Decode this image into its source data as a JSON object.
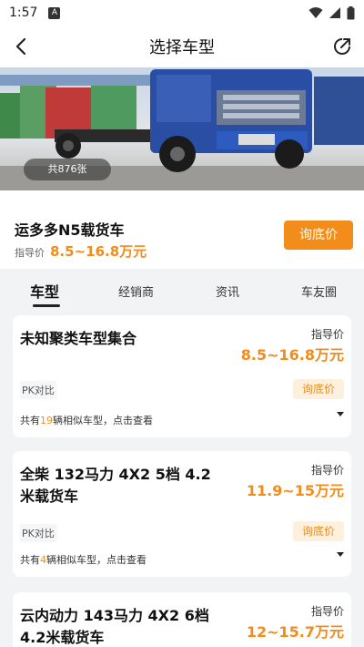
{
  "status_bar": {
    "time": "1:57",
    "app_indicator": "A"
  },
  "nav": {
    "title": "选择车型",
    "back_icon": "back-arrow-icon",
    "share_icon": "share-icon"
  },
  "hero": {
    "photo_count": "共876张"
  },
  "summary": {
    "model_name": "运多多N5载货车",
    "price_label": "指导价",
    "price_value": "8.5~16.8万元",
    "inquiry_button": "询底价"
  },
  "tabs": [
    "车型",
    "经销商",
    "资讯",
    "车友圈"
  ],
  "colors": {
    "accent": "#f28c1a",
    "background": "#f2f3f5"
  },
  "cards": [
    {
      "name": "未知聚类车型集合",
      "guide_label": "指导价",
      "guide_price": "8.5~16.8万元",
      "pk": "PK对比",
      "inquiry": "询底价",
      "similar_prefix": "共有",
      "similar_count": "19",
      "similar_suffix": "辆相似车型，点击查看"
    },
    {
      "name": "全柴 132马力 4X2 5档 4.2米载货车",
      "guide_label": "指导价",
      "guide_price": "11.9~15万元",
      "pk": "PK对比",
      "inquiry": "询底价",
      "similar_prefix": "共有",
      "similar_count": "4",
      "similar_suffix": "辆相似车型，点击查看"
    },
    {
      "name": "云内动力 143马力 4X2 6档 4.2米载货车",
      "guide_label": "指导价",
      "guide_price": "12~15.7万元"
    }
  ]
}
